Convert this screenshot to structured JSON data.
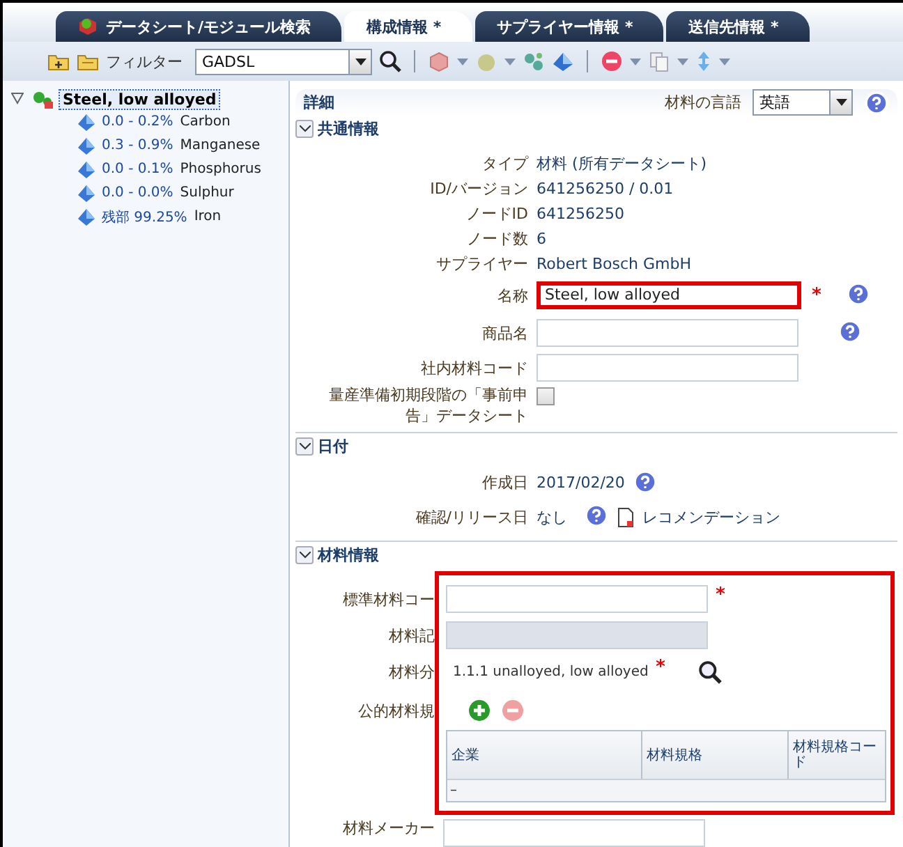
{
  "tabs": [
    {
      "label": "データシート/モジュール検索",
      "selected": false
    },
    {
      "label": "構成情報 *",
      "selected": true
    },
    {
      "label": "サプライヤー情報 *",
      "selected": false
    },
    {
      "label": "送信先情報 *",
      "selected": false
    }
  ],
  "toolbar": {
    "filter_label": "フィルター",
    "filter_value": "GADSL"
  },
  "tree": {
    "label": "Steel, low alloyed",
    "expanded": true,
    "selected": true,
    "children": [
      {
        "range": "0.0 - 0.2%",
        "name": "Carbon"
      },
      {
        "range": "0.3 - 0.9%",
        "name": "Manganese"
      },
      {
        "range": "0.0 - 0.1%",
        "name": "Phosphorus"
      },
      {
        "range": "0.0 - 0.0%",
        "name": "Sulphur"
      },
      {
        "range": "残部  99.25%",
        "name": "Iron"
      }
    ]
  },
  "detail": {
    "title": "詳細",
    "language_label": "材料の言語",
    "language_value": "英語"
  },
  "common": {
    "title": "共通情報",
    "expanded": true,
    "info": [
      {
        "label": "タイプ",
        "value": "材料 (所有データシート)"
      },
      {
        "label": "ID/バージョン",
        "value": "641256250 / 0.01"
      },
      {
        "label": "ノードID",
        "value": "641256250"
      },
      {
        "label": "ノード数",
        "value": "6"
      },
      {
        "label": "サプライヤー",
        "value": "Robert Bosch GmbH"
      }
    ],
    "name": {
      "label": "名称",
      "value": "Steel, low alloyed",
      "required": true,
      "highlighted": true
    },
    "trade_name": {
      "label": "商品名"
    },
    "internal_code": {
      "label": "社内材料コード"
    },
    "preannounce": {
      "label": "量産準備初期段階の「事前申告」データシート",
      "checked": false
    }
  },
  "dates": {
    "title": "日付",
    "expanded": true,
    "created_label": "作成日",
    "created_value": "2017/02/20",
    "release_label": "確認/リリース日",
    "release_value": "なし",
    "link": "レコメンデーション"
  },
  "material": {
    "title": "材料情報",
    "expanded": true,
    "highlighted": true,
    "standard_code": {
      "label": "標準材料コー",
      "required": true
    },
    "symbol": {
      "label": "材料記",
      "disabled": true
    },
    "classification": {
      "label": "材料分",
      "value": "1.1.1 unalloyed, low alloyed",
      "required": true
    },
    "public_standard_label": "公的材料規",
    "table": {
      "columns": [
        "企業",
        "材料規格",
        "材料規格コード"
      ],
      "rows": [
        [
          "–"
        ]
      ]
    },
    "maker_label": "材料メーカー"
  }
}
